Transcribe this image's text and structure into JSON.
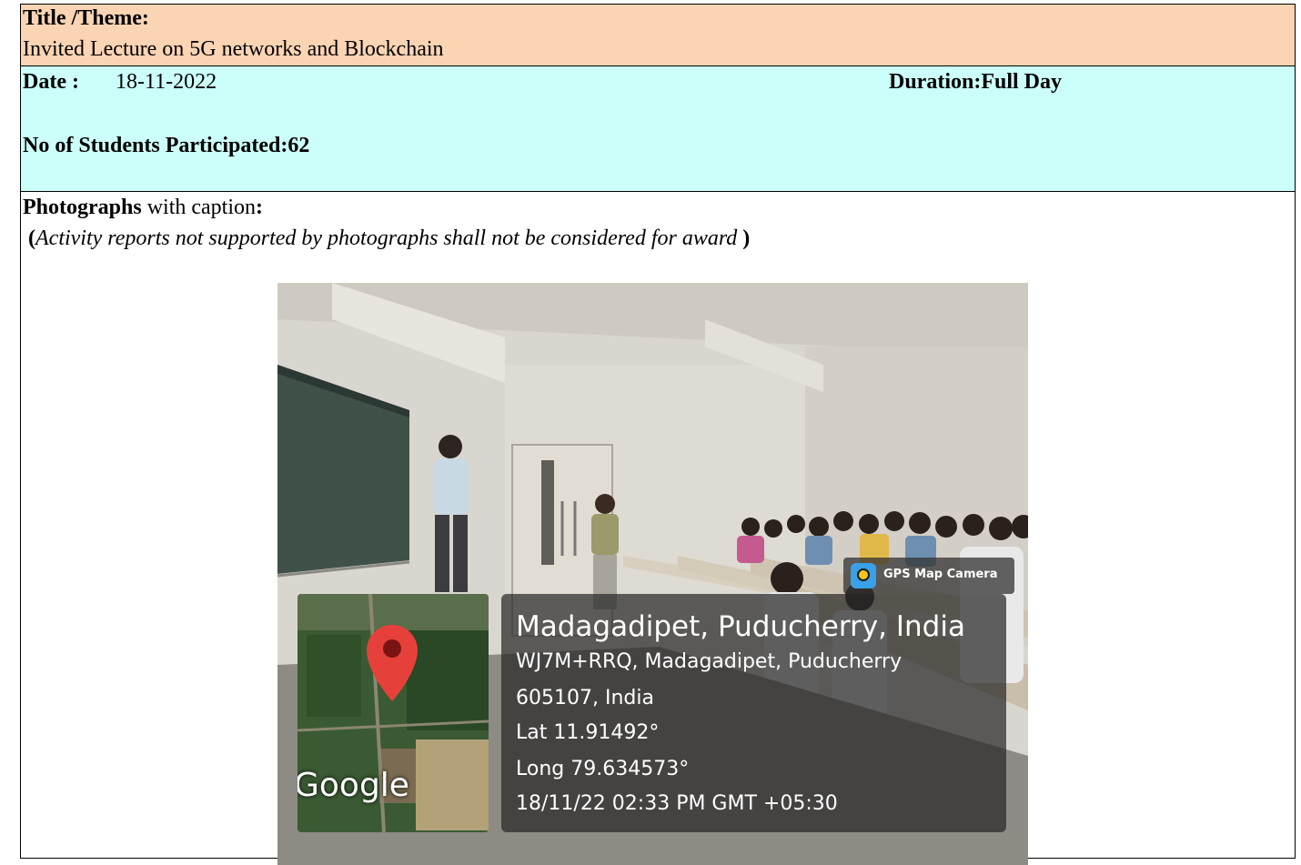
{
  "title": {
    "label": "Title /Theme:",
    "value": "Invited Lecture on 5G networks and Blockchain"
  },
  "info": {
    "date_label": "Date :",
    "date_value": "18-11-2022",
    "duration": "Duration:Full Day",
    "students": "No of Students Participated:62"
  },
  "photographs": {
    "label_bold": "Photographs",
    "label_rest": " with caption",
    "label_colon": ":",
    "note_open": "(",
    "note_text": "Activity reports not supported by photographs shall not be considered for award",
    "note_close": " )"
  },
  "gps": {
    "app_name": "GPS Map Camera",
    "place": "Madagadipet, Puducherry, India",
    "address_line1": "WJ7M+RRQ, Madagadipet, Puducherry",
    "address_line2": "605107, India",
    "lat": "Lat 11.91492°",
    "long": "Long 79.634573°",
    "timestamp": "18/11/22 02:33 PM GMT +05:30",
    "map_brand": "Google"
  }
}
